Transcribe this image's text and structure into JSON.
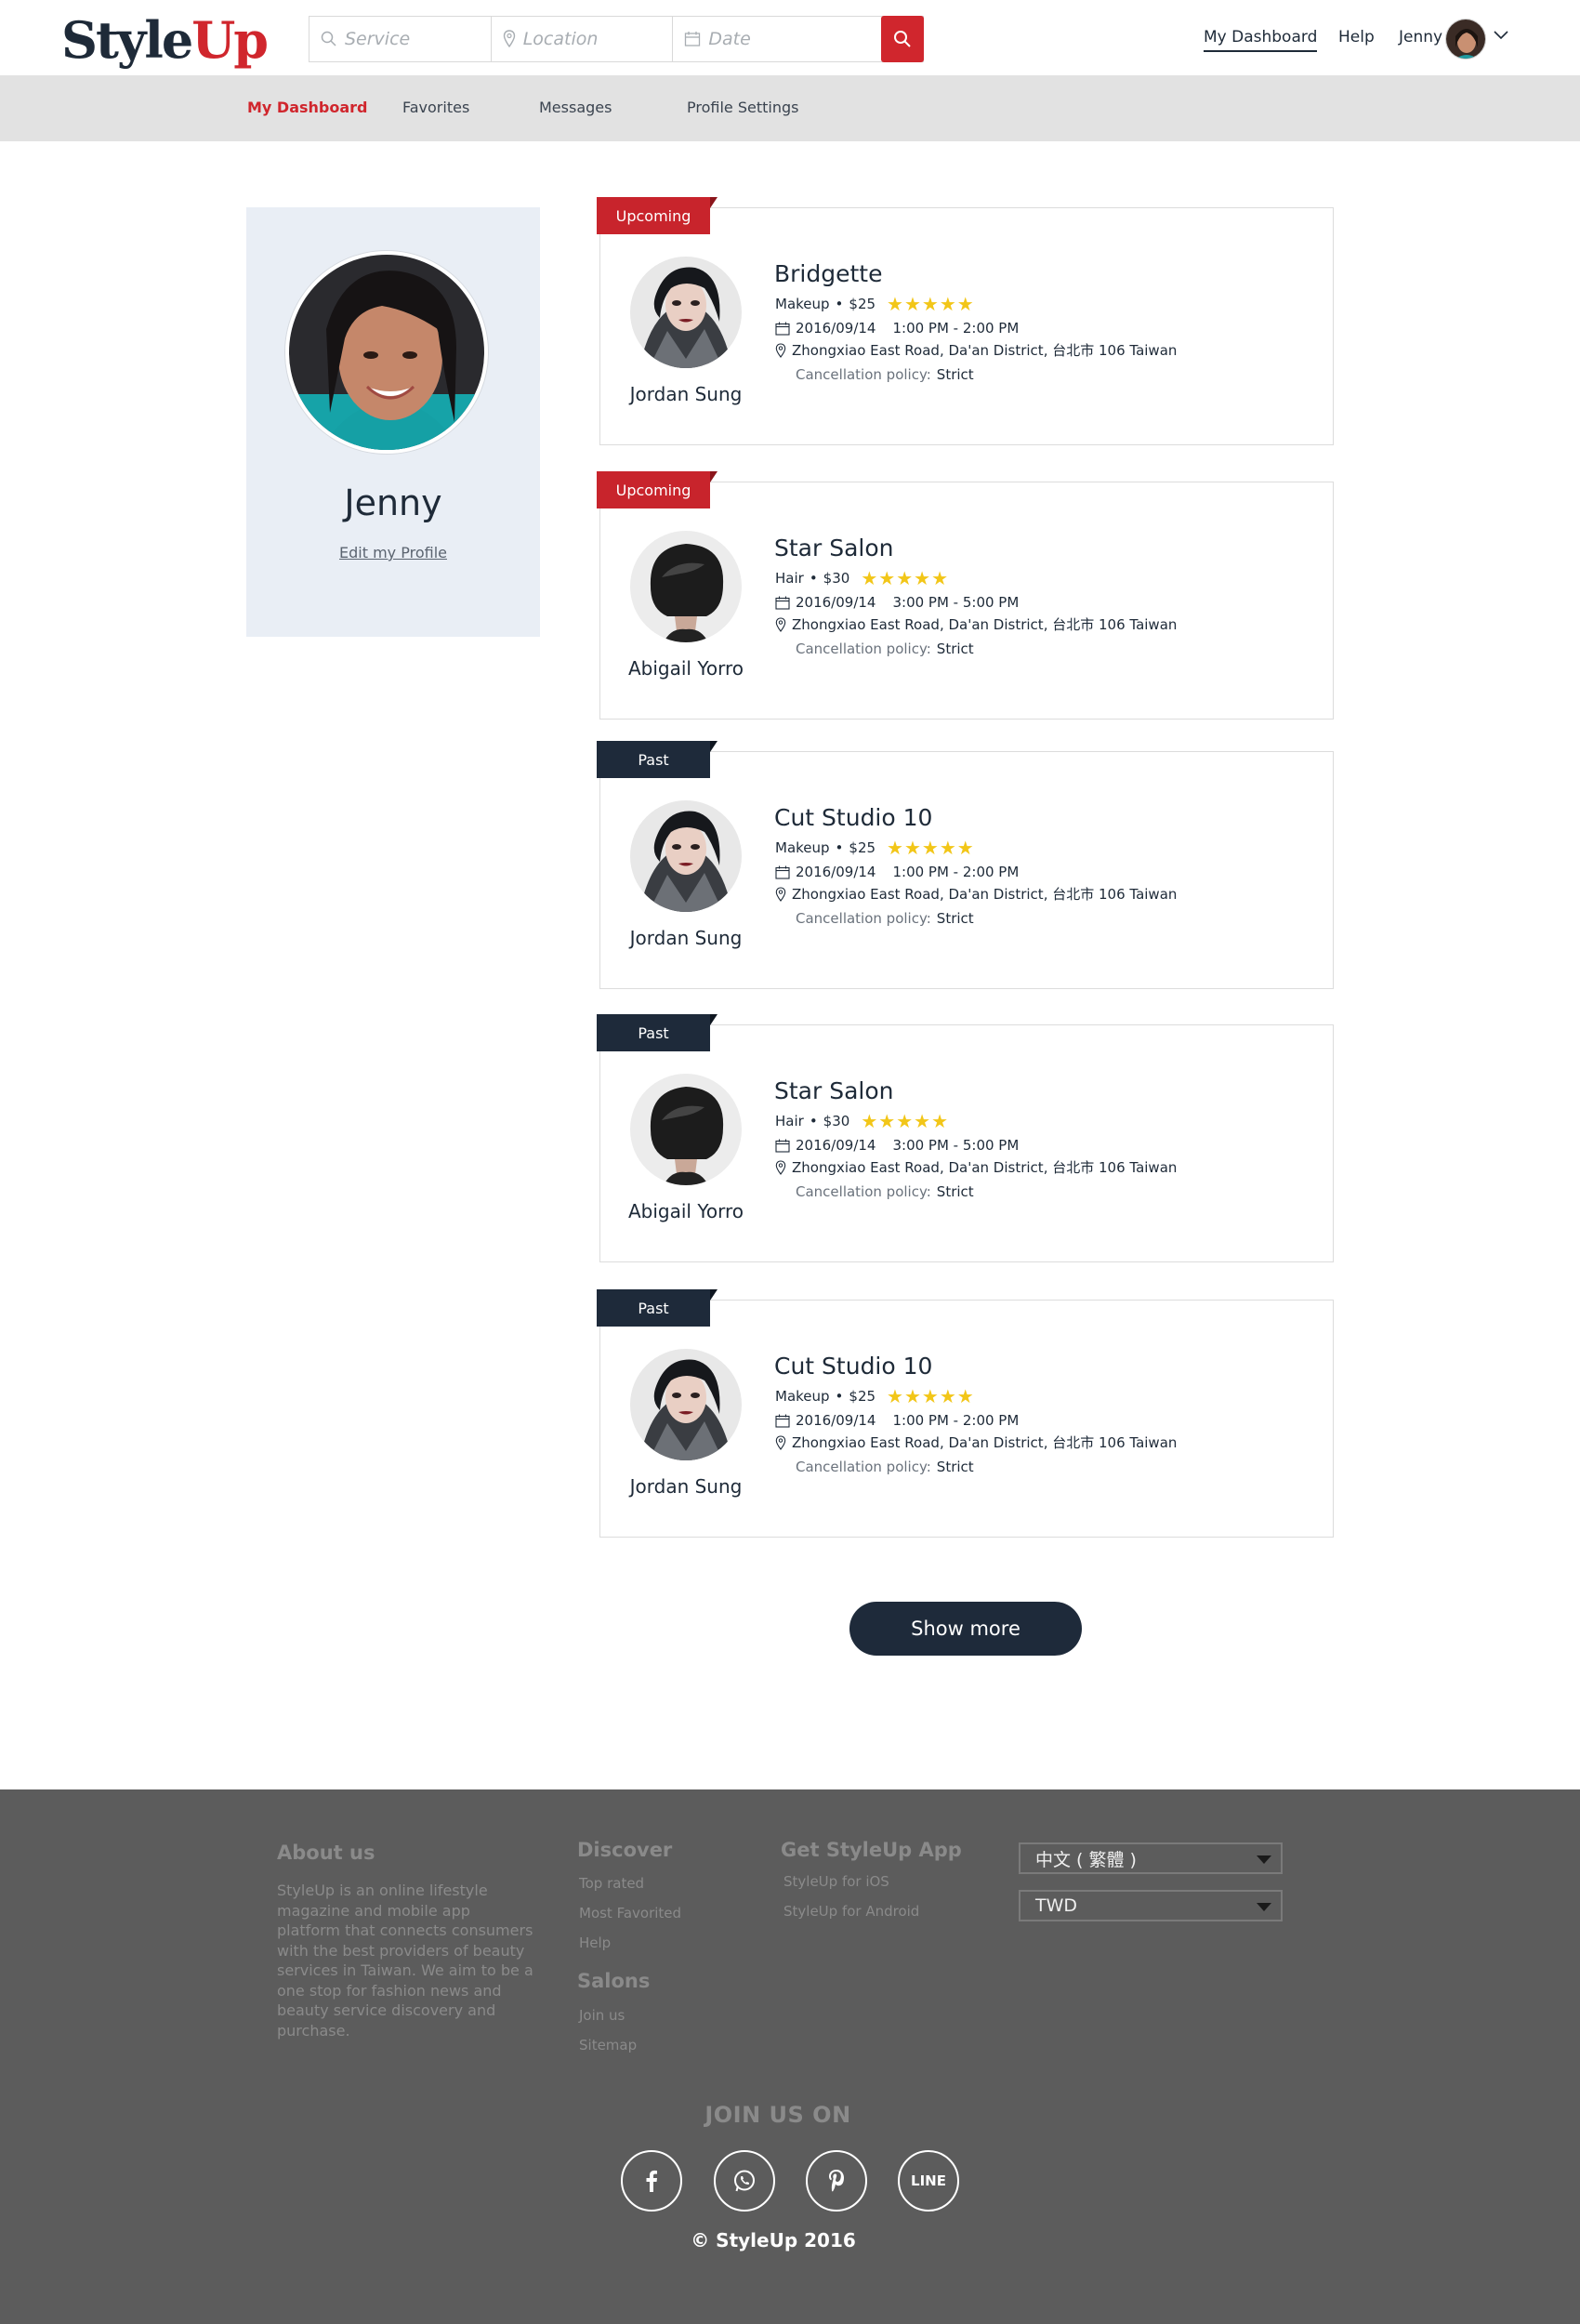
{
  "header": {
    "logo_part1": "Style",
    "logo_part2": "Up",
    "search": {
      "service_placeholder": "Service",
      "location_placeholder": "Location",
      "date_placeholder": "Date"
    },
    "nav": {
      "dashboard": "My Dashboard",
      "help": "Help",
      "user": "Jenny"
    }
  },
  "subnav": {
    "items": [
      "My Dashboard",
      "Favorites",
      "Messages",
      "Profile Settings"
    ],
    "active": "My Dashboard"
  },
  "profile": {
    "name": "Jenny",
    "edit_label": "Edit my Profile"
  },
  "bookings": [
    {
      "status": "Upcoming",
      "title": "Bridgette",
      "service": "Makeup",
      "price": "$25",
      "rating": 5,
      "date": "2016/09/14",
      "time": "1:00 PM - 2:00 PM",
      "address": "Zhongxiao East Road, Da'an District, 台北市 106 Taiwan",
      "policy_label": "Cancellation policy:",
      "policy_value": "Strict",
      "professional": "Jordan Sung",
      "avatar_icon": "makeup-artist-photo"
    },
    {
      "status": "Upcoming",
      "title": "Star Salon",
      "service": "Hair",
      "price": "$30",
      "rating": 5,
      "date": "2016/09/14",
      "time": "3:00 PM - 5:00 PM",
      "address": "Zhongxiao East Road, Da'an District, 台北市 106 Taiwan",
      "policy_label": "Cancellation policy:",
      "policy_value": "Strict",
      "professional": "Abigail Yorro",
      "avatar_icon": "haircut-photo"
    },
    {
      "status": "Past",
      "title": "Cut Studio 10",
      "service": "Makeup",
      "price": "$25",
      "rating": 5,
      "date": "2016/09/14",
      "time": "1:00 PM - 2:00 PM",
      "address": "Zhongxiao East Road, Da'an District, 台北市 106 Taiwan",
      "policy_label": "Cancellation policy:",
      "policy_value": "Strict",
      "professional": "Jordan Sung",
      "avatar_icon": "makeup-artist-photo"
    },
    {
      "status": "Past",
      "title": "Star Salon",
      "service": "Hair",
      "price": "$30",
      "rating": 5,
      "date": "2016/09/14",
      "time": "3:00 PM - 5:00 PM",
      "address": "Zhongxiao East Road, Da'an District, 台北市 106 Taiwan",
      "policy_label": "Cancellation policy:",
      "policy_value": "Strict",
      "professional": "Abigail Yorro",
      "avatar_icon": "haircut-photo"
    },
    {
      "status": "Past",
      "title": "Cut Studio 10",
      "service": "Makeup",
      "price": "$25",
      "rating": 5,
      "date": "2016/09/14",
      "time": "1:00 PM - 2:00 PM",
      "address": "Zhongxiao East Road, Da'an District, 台北市 106 Taiwan",
      "policy_label": "Cancellation policy:",
      "policy_value": "Strict",
      "professional": "Jordan Sung",
      "avatar_icon": "makeup-artist-photo"
    }
  ],
  "show_more_label": "Show more",
  "footer": {
    "about_title": "About us",
    "about_text": "StyleUp is an online lifestyle magazine and mobile app platform that connects consumers with the best providers of beauty services in Taiwan. We aim to be a one stop for fashion news and beauty service discovery and purchase.",
    "discover_title": "Discover",
    "discover_links": [
      "Top rated",
      "Most Favorited",
      "Help"
    ],
    "salons_title": "Salons",
    "salons_links": [
      "Join us",
      "Sitemap"
    ],
    "app_title": "Get StyleUp App",
    "app_links": [
      "StyleUp for iOS",
      "StyleUp for Android"
    ],
    "language": "中文 ( 繁體 )",
    "currency": "TWD",
    "join_title": "JOIN US ON",
    "social": [
      "facebook-icon",
      "whatsapp-icon",
      "pinterest-icon",
      "line-icon"
    ],
    "line_label": "LINE",
    "copyright": "© StyleUp 2016"
  },
  "colors": {
    "brand_red": "#d0262d",
    "navy": "#1e2a3a",
    "footer_bg": "#5c5c5c",
    "star": "#f2c618"
  }
}
